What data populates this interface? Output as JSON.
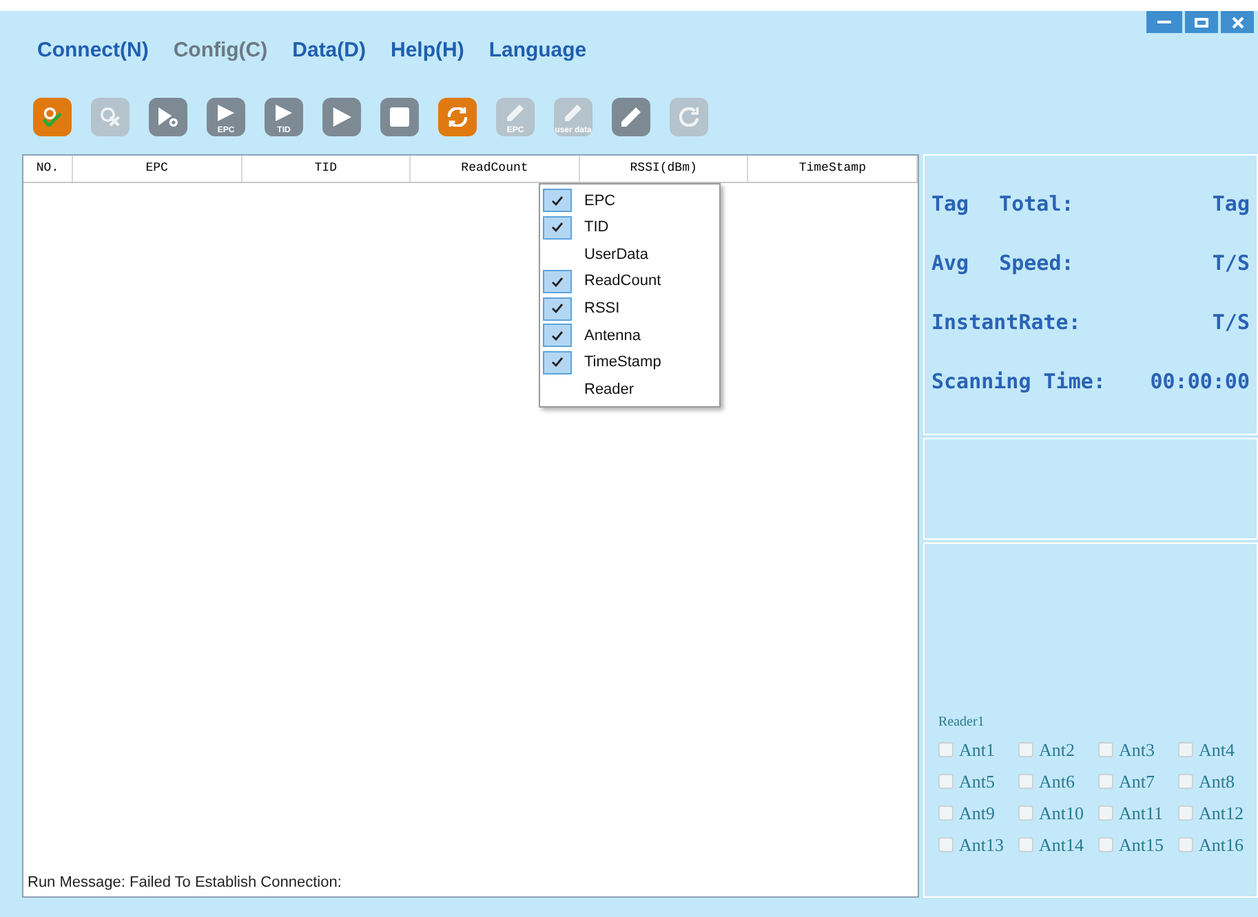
{
  "menu": [
    {
      "label": "Connect(N)",
      "disabled": false
    },
    {
      "label": "Config(C)",
      "disabled": true
    },
    {
      "label": "Data(D)",
      "disabled": false
    },
    {
      "label": "Help(H)",
      "disabled": false
    },
    {
      "label": "Language",
      "disabled": false
    }
  ],
  "toolbar": [
    {
      "kind": "connect",
      "highlighted": true,
      "disabled": false
    },
    {
      "kind": "disconnect",
      "highlighted": false,
      "disabled": true
    },
    {
      "kind": "play-gear",
      "highlighted": false,
      "disabled": false
    },
    {
      "kind": "play-tag",
      "label": "EPC",
      "highlighted": false,
      "disabled": false
    },
    {
      "kind": "play-tag",
      "label": "TID",
      "highlighted": false,
      "disabled": false
    },
    {
      "kind": "play",
      "highlighted": false,
      "disabled": false
    },
    {
      "kind": "stop",
      "highlighted": false,
      "disabled": false
    },
    {
      "kind": "refresh",
      "highlighted": true,
      "disabled": false
    },
    {
      "kind": "pencil-tag",
      "label": "EPC",
      "highlighted": false,
      "disabled": true
    },
    {
      "kind": "pencil-tag",
      "label": "user data",
      "highlighted": false,
      "disabled": true
    },
    {
      "kind": "pencil",
      "highlighted": false,
      "disabled": false
    },
    {
      "kind": "reset",
      "highlighted": false,
      "disabled": true
    }
  ],
  "table": {
    "columns": [
      "NO.",
      "EPC",
      "TID",
      "ReadCount",
      "RSSI(dBm)",
      "TimeStamp"
    ]
  },
  "column_menu": [
    {
      "label": "EPC",
      "checked": true
    },
    {
      "label": "TID",
      "checked": true
    },
    {
      "label": "UserData",
      "checked": false
    },
    {
      "label": "ReadCount",
      "checked": true
    },
    {
      "label": "RSSI",
      "checked": true
    },
    {
      "label": "Antenna",
      "checked": true
    },
    {
      "label": "TimeStamp",
      "checked": true
    },
    {
      "label": "Reader",
      "checked": false
    }
  ],
  "stats": [
    [
      "Tag",
      "Total:",
      "Tag"
    ],
    [
      "Avg",
      "Speed:",
      "T/S"
    ],
    [
      "InstantRate:",
      "T/S"
    ],
    [
      "Scanning Time:",
      "00:00:00"
    ]
  ],
  "antennas": {
    "reader": "Reader1",
    "items": [
      {
        "label": "Ant1",
        "checked": false
      },
      {
        "label": "Ant2",
        "checked": false
      },
      {
        "label": "Ant3",
        "checked": false
      },
      {
        "label": "Ant4",
        "checked": false
      },
      {
        "label": "Ant5",
        "checked": false
      },
      {
        "label": "Ant6",
        "checked": false
      },
      {
        "label": "Ant7",
        "checked": false
      },
      {
        "label": "Ant8",
        "checked": false
      },
      {
        "label": "Ant9",
        "checked": false
      },
      {
        "label": "Ant10",
        "checked": false
      },
      {
        "label": "Ant11",
        "checked": false
      },
      {
        "label": "Ant12",
        "checked": false
      },
      {
        "label": "Ant13",
        "checked": false
      },
      {
        "label": "Ant14",
        "checked": false
      },
      {
        "label": "Ant15",
        "checked": false
      },
      {
        "label": "Ant16",
        "checked": false
      }
    ]
  },
  "status_bar": "Run Message: Failed To Establish Connection:"
}
